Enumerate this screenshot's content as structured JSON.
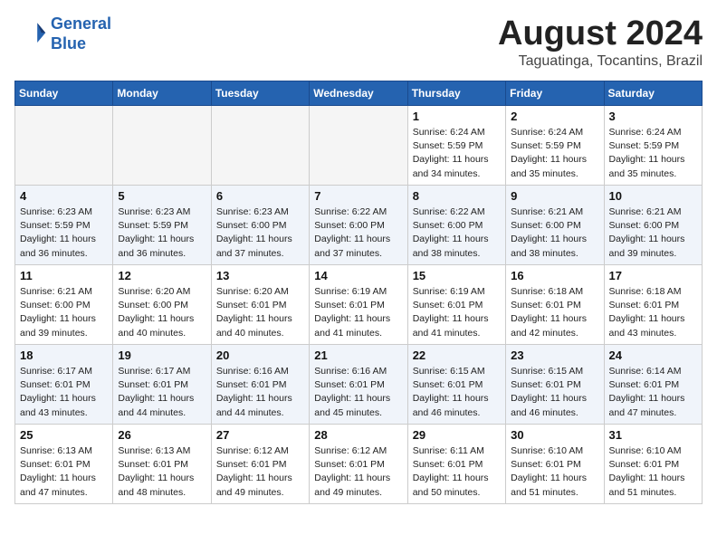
{
  "header": {
    "logo_line1": "General",
    "logo_line2": "Blue",
    "month": "August 2024",
    "location": "Taguatinga, Tocantins, Brazil"
  },
  "weekdays": [
    "Sunday",
    "Monday",
    "Tuesday",
    "Wednesday",
    "Thursday",
    "Friday",
    "Saturday"
  ],
  "weeks": [
    [
      {
        "day": "",
        "info": ""
      },
      {
        "day": "",
        "info": ""
      },
      {
        "day": "",
        "info": ""
      },
      {
        "day": "",
        "info": ""
      },
      {
        "day": "1",
        "info": "Sunrise: 6:24 AM\nSunset: 5:59 PM\nDaylight: 11 hours\nand 34 minutes."
      },
      {
        "day": "2",
        "info": "Sunrise: 6:24 AM\nSunset: 5:59 PM\nDaylight: 11 hours\nand 35 minutes."
      },
      {
        "day": "3",
        "info": "Sunrise: 6:24 AM\nSunset: 5:59 PM\nDaylight: 11 hours\nand 35 minutes."
      }
    ],
    [
      {
        "day": "4",
        "info": "Sunrise: 6:23 AM\nSunset: 5:59 PM\nDaylight: 11 hours\nand 36 minutes."
      },
      {
        "day": "5",
        "info": "Sunrise: 6:23 AM\nSunset: 5:59 PM\nDaylight: 11 hours\nand 36 minutes."
      },
      {
        "day": "6",
        "info": "Sunrise: 6:23 AM\nSunset: 6:00 PM\nDaylight: 11 hours\nand 37 minutes."
      },
      {
        "day": "7",
        "info": "Sunrise: 6:22 AM\nSunset: 6:00 PM\nDaylight: 11 hours\nand 37 minutes."
      },
      {
        "day": "8",
        "info": "Sunrise: 6:22 AM\nSunset: 6:00 PM\nDaylight: 11 hours\nand 38 minutes."
      },
      {
        "day": "9",
        "info": "Sunrise: 6:21 AM\nSunset: 6:00 PM\nDaylight: 11 hours\nand 38 minutes."
      },
      {
        "day": "10",
        "info": "Sunrise: 6:21 AM\nSunset: 6:00 PM\nDaylight: 11 hours\nand 39 minutes."
      }
    ],
    [
      {
        "day": "11",
        "info": "Sunrise: 6:21 AM\nSunset: 6:00 PM\nDaylight: 11 hours\nand 39 minutes."
      },
      {
        "day": "12",
        "info": "Sunrise: 6:20 AM\nSunset: 6:00 PM\nDaylight: 11 hours\nand 40 minutes."
      },
      {
        "day": "13",
        "info": "Sunrise: 6:20 AM\nSunset: 6:01 PM\nDaylight: 11 hours\nand 40 minutes."
      },
      {
        "day": "14",
        "info": "Sunrise: 6:19 AM\nSunset: 6:01 PM\nDaylight: 11 hours\nand 41 minutes."
      },
      {
        "day": "15",
        "info": "Sunrise: 6:19 AM\nSunset: 6:01 PM\nDaylight: 11 hours\nand 41 minutes."
      },
      {
        "day": "16",
        "info": "Sunrise: 6:18 AM\nSunset: 6:01 PM\nDaylight: 11 hours\nand 42 minutes."
      },
      {
        "day": "17",
        "info": "Sunrise: 6:18 AM\nSunset: 6:01 PM\nDaylight: 11 hours\nand 43 minutes."
      }
    ],
    [
      {
        "day": "18",
        "info": "Sunrise: 6:17 AM\nSunset: 6:01 PM\nDaylight: 11 hours\nand 43 minutes."
      },
      {
        "day": "19",
        "info": "Sunrise: 6:17 AM\nSunset: 6:01 PM\nDaylight: 11 hours\nand 44 minutes."
      },
      {
        "day": "20",
        "info": "Sunrise: 6:16 AM\nSunset: 6:01 PM\nDaylight: 11 hours\nand 44 minutes."
      },
      {
        "day": "21",
        "info": "Sunrise: 6:16 AM\nSunset: 6:01 PM\nDaylight: 11 hours\nand 45 minutes."
      },
      {
        "day": "22",
        "info": "Sunrise: 6:15 AM\nSunset: 6:01 PM\nDaylight: 11 hours\nand 46 minutes."
      },
      {
        "day": "23",
        "info": "Sunrise: 6:15 AM\nSunset: 6:01 PM\nDaylight: 11 hours\nand 46 minutes."
      },
      {
        "day": "24",
        "info": "Sunrise: 6:14 AM\nSunset: 6:01 PM\nDaylight: 11 hours\nand 47 minutes."
      }
    ],
    [
      {
        "day": "25",
        "info": "Sunrise: 6:13 AM\nSunset: 6:01 PM\nDaylight: 11 hours\nand 47 minutes."
      },
      {
        "day": "26",
        "info": "Sunrise: 6:13 AM\nSunset: 6:01 PM\nDaylight: 11 hours\nand 48 minutes."
      },
      {
        "day": "27",
        "info": "Sunrise: 6:12 AM\nSunset: 6:01 PM\nDaylight: 11 hours\nand 49 minutes."
      },
      {
        "day": "28",
        "info": "Sunrise: 6:12 AM\nSunset: 6:01 PM\nDaylight: 11 hours\nand 49 minutes."
      },
      {
        "day": "29",
        "info": "Sunrise: 6:11 AM\nSunset: 6:01 PM\nDaylight: 11 hours\nand 50 minutes."
      },
      {
        "day": "30",
        "info": "Sunrise: 6:10 AM\nSunset: 6:01 PM\nDaylight: 11 hours\nand 51 minutes."
      },
      {
        "day": "31",
        "info": "Sunrise: 6:10 AM\nSunset: 6:01 PM\nDaylight: 11 hours\nand 51 minutes."
      }
    ]
  ]
}
